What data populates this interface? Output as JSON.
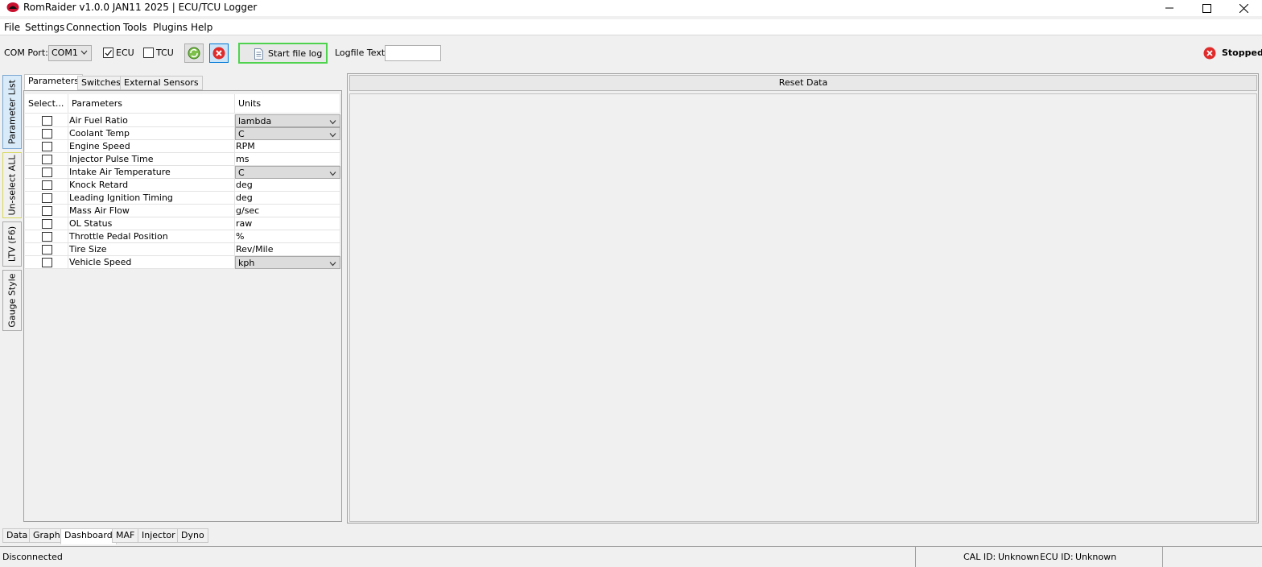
{
  "window": {
    "title": "RomRaider v1.0.0 JAN11 2025 | ECU/TCU Logger"
  },
  "menu": {
    "items": [
      "File",
      "Settings",
      "Connection",
      "Tools",
      "Plugins",
      "Help"
    ]
  },
  "toolbar": {
    "com_port_label": "COM Port:",
    "com_port_value": "COM1",
    "ecu_label": "ECU",
    "ecu_checked": true,
    "tcu_label": "TCU",
    "tcu_checked": false,
    "start_log_label": "Start file log",
    "logfile_text_label": "Logfile Text",
    "logfile_text_value": "",
    "status_label": "Stopped"
  },
  "side_tabs": [
    "Parameter List",
    "Un-select ALL",
    "LTV (F6)",
    "Gauge Style"
  ],
  "panel_tabs": [
    "Parameters",
    "Switches",
    "External Sensors"
  ],
  "table": {
    "headers": [
      "Select...",
      "Parameters",
      "Units"
    ],
    "rows": [
      {
        "name": "Air Fuel Ratio",
        "unit": "lambda",
        "dropdown": true
      },
      {
        "name": "Coolant Temp",
        "unit": "C",
        "dropdown": true
      },
      {
        "name": "Engine Speed",
        "unit": "RPM",
        "dropdown": false
      },
      {
        "name": "Injector Pulse Time",
        "unit": "ms",
        "dropdown": false
      },
      {
        "name": "Intake Air Temperature",
        "unit": "C",
        "dropdown": true
      },
      {
        "name": "Knock Retard",
        "unit": "deg",
        "dropdown": false
      },
      {
        "name": "Leading Ignition Timing",
        "unit": "deg",
        "dropdown": false
      },
      {
        "name": "Mass Air Flow",
        "unit": "g/sec",
        "dropdown": false
      },
      {
        "name": "OL Status",
        "unit": "raw",
        "dropdown": false
      },
      {
        "name": "Throttle Pedal Position",
        "unit": "%",
        "dropdown": false
      },
      {
        "name": "Tire Size",
        "unit": "Rev/Mile",
        "dropdown": false
      },
      {
        "name": "Vehicle Speed",
        "unit": "kph",
        "dropdown": true
      }
    ]
  },
  "right_panel": {
    "reset_label": "Reset Data"
  },
  "bottom_tabs": [
    "Data",
    "Graph",
    "Dashboard",
    "MAF",
    "Injector",
    "Dyno"
  ],
  "bottom_tab_active": "Dashboard",
  "status": {
    "connection": "Disconnected",
    "cal_id_label": "CAL ID:",
    "cal_id_value": "Unknown",
    "ecu_id_label": "ECU ID:",
    "ecu_id_value": "Unknown"
  },
  "colors": {
    "start_log_border": "#4fd34f",
    "stop_red": "#e02b2b",
    "active_tab_blue": "#d9ebf9"
  },
  "icons": {
    "app": "romraider-logo-icon",
    "reconnect": "refresh-icon",
    "disconnect": "close-circle-icon",
    "log": "document-icon",
    "stopped": "stop-circle-icon"
  }
}
